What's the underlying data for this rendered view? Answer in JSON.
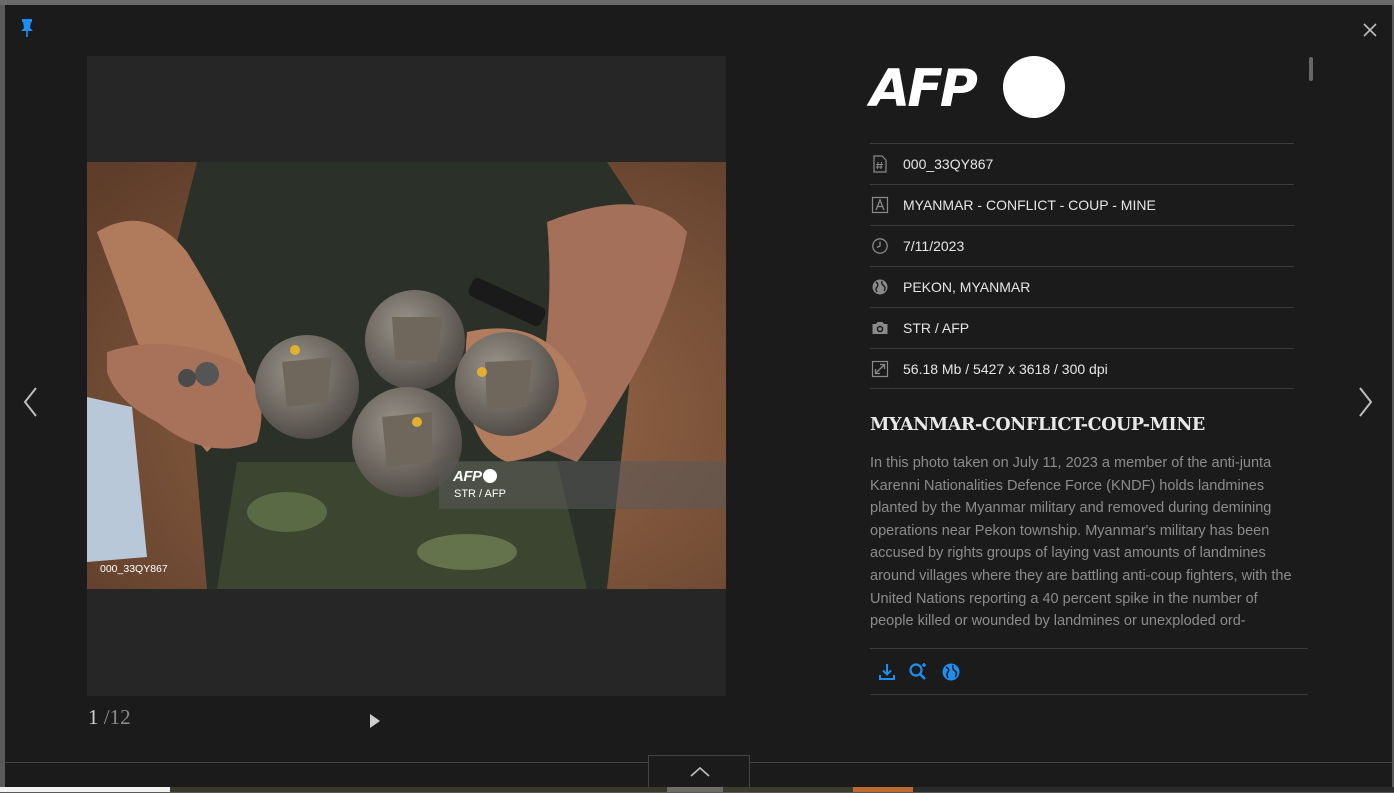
{
  "logo": {
    "text": "AFP"
  },
  "photo": {
    "watermark_logo": "AFP",
    "watermark_credit": "STR / AFP",
    "watermark_id": "000_33QY867"
  },
  "pager": {
    "current": "1",
    "total": "/12"
  },
  "metadata": [
    {
      "icon": "hash-icon",
      "value": "000_33QY867"
    },
    {
      "icon": "text-icon",
      "value": "MYANMAR - CONFLICT - COUP - MINE"
    },
    {
      "icon": "clock-icon",
      "value": "7/11/2023"
    },
    {
      "icon": "globe-icon",
      "value": "PEKON, MYANMAR"
    },
    {
      "icon": "camera-icon",
      "value": "STR / AFP"
    },
    {
      "icon": "resize-icon",
      "value": "56.18 Mb / 5427 x 3618 / 300 dpi"
    }
  ],
  "headline": "MYANMAR-CONFLICT-COUP-MINE",
  "caption": "In this photo taken on July 11, 2023 a member of the anti-junta Karenni Nationalities Defence Force (KNDF) holds landmines planted by the Myanmar military and removed during demining operations near Pekon township. Myanmar's military has been accused by rights groups of laying vast amounts of landmines around villages where they are battling anti-coup fighters, with the United Nations reporting a 40 percent spike in the number of people killed or wounded by landmines or unexploded ord-",
  "actions": [
    {
      "icon": "download-icon"
    },
    {
      "icon": "search-similar-icon"
    },
    {
      "icon": "globe-icon"
    }
  ],
  "colors": {
    "accent": "#1f8ef1",
    "background": "#1b1b1b",
    "panel": "#262626"
  }
}
